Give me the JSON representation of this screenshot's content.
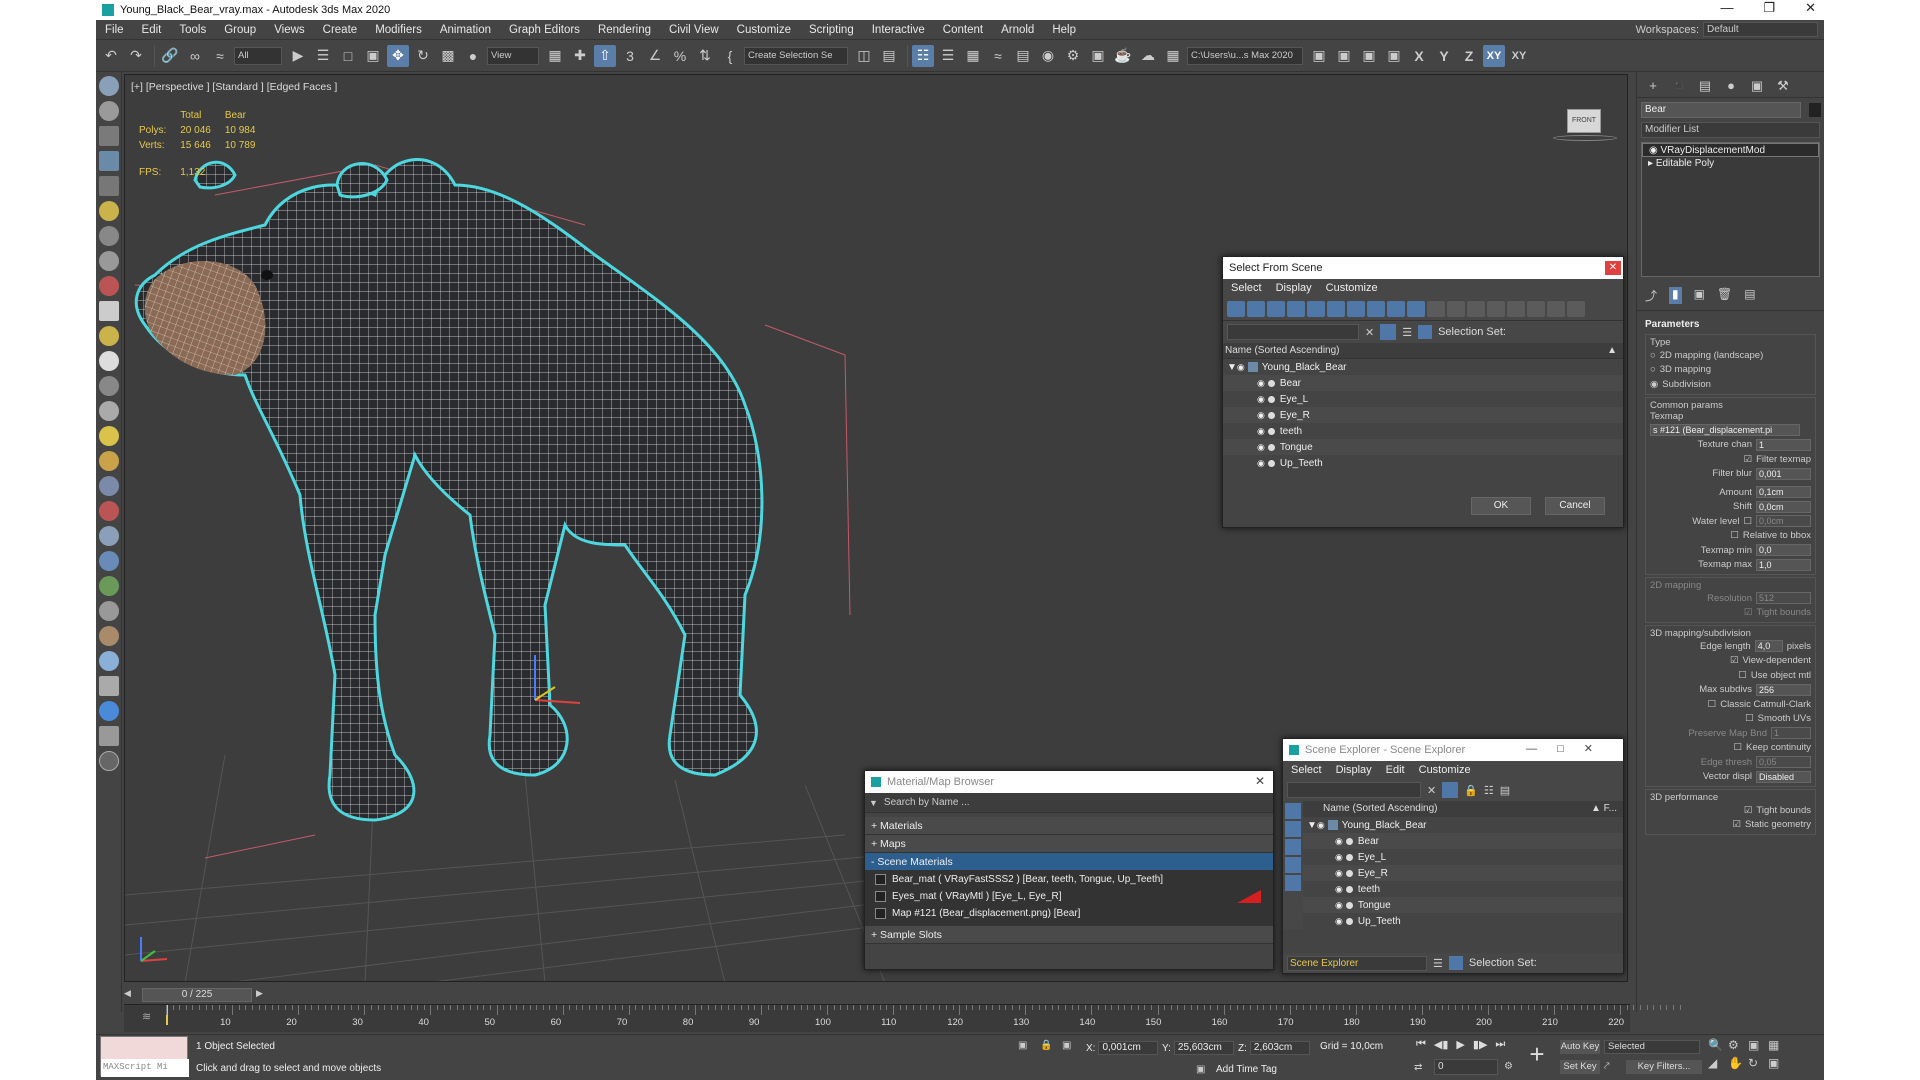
{
  "window": {
    "title": "Young_Black_Bear_vray.max - Autodesk 3ds Max 2020"
  },
  "menu": [
    "File",
    "Edit",
    "Tools",
    "Group",
    "Views",
    "Create",
    "Modifiers",
    "Animation",
    "Graph Editors",
    "Rendering",
    "Civil View",
    "Customize",
    "Scripting",
    "Interactive",
    "Content",
    "Arnold",
    "Help"
  ],
  "workspace": {
    "label": "Workspaces:",
    "value": "Default"
  },
  "toolbar": {
    "filter": "All",
    "ref_coord": "View",
    "selection_set": "Create Selection Se",
    "path": "C:\\Users\\u...s Max 2020",
    "axis": [
      "X",
      "Y",
      "Z",
      "XY",
      "XY"
    ]
  },
  "viewport": {
    "label": "[+] [Perspective ] [Standard ] [Edged Faces ]",
    "stats": {
      "col_total": "Total",
      "col_obj": "Bear",
      "polys_label": "Polys:",
      "polys_total": "20 046",
      "polys_obj": "10 984",
      "verts_label": "Verts:",
      "verts_total": "15 646",
      "verts_obj": "10 789",
      "fps_label": "FPS:",
      "fps": "1,132"
    },
    "viewcube": "FRONT"
  },
  "command_panel": {
    "object_name": "Bear",
    "modifier_list": "Modifier List",
    "stack": [
      "VRayDisplacementMod",
      "Editable Poly"
    ],
    "parameters": {
      "title": "Parameters",
      "type_label": "Type",
      "types": [
        "2D mapping (landscape)",
        "3D mapping",
        "Subdivision"
      ],
      "common": "Common params",
      "texmap_label": "Texmap",
      "texmap": "s #121 (Bear_displacement.pi",
      "texture_chan_label": "Texture chan",
      "texture_chan": "1",
      "filter_texmap": "Filter texmap",
      "filter_blur_label": "Filter blur",
      "filter_blur": "0,001",
      "amount_label": "Amount",
      "amount": "0,1cm",
      "shift_label": "Shift",
      "shift": "0,0cm",
      "water_label": "Water level",
      "water": "0,0cm",
      "relative_bbox": "Relative to bbox",
      "texmap_min_label": "Texmap min",
      "texmap_min": "0,0",
      "texmap_max_label": "Texmap max",
      "texmap_max": "1,0",
      "mapping2d": "2D mapping",
      "resolution_label": "Resolution",
      "resolution": "512",
      "tight_bounds": "Tight bounds",
      "mapping3d": "3D mapping/subdivision",
      "edge_length_label": "Edge length",
      "edge_length": "4,0",
      "pixels": "pixels",
      "view_dependent": "View-dependent",
      "use_object_mtl": "Use object mtl",
      "max_subdivs_label": "Max subdivs",
      "max_subdivs": "256",
      "catmull": "Classic Catmull-Clark",
      "smooth_uvs": "Smooth UVs",
      "preserve_label": "Preserve Map Bnd",
      "preserve": "1",
      "keep_continuity": "Keep continuity",
      "edge_thresh_label": "Edge thresh",
      "edge_thresh": "0,05",
      "vector_disp_label": "Vector displ",
      "vector_disp": "Disabled",
      "perf": "3D performance",
      "tight_bounds2": "Tight bounds",
      "static_geometry": "Static geometry"
    }
  },
  "select_dialog": {
    "title": "Select From Scene",
    "menu": [
      "Select",
      "Display",
      "Customize"
    ],
    "selection_set": "Selection Set:",
    "header": "Name (Sorted Ascending)",
    "root": "Young_Black_Bear",
    "items": [
      "Bear",
      "Eye_L",
      "Eye_R",
      "teeth",
      "Tongue",
      "Up_Teeth"
    ],
    "ok": "OK",
    "cancel": "Cancel"
  },
  "material_browser": {
    "title": "Material/Map Browser",
    "search": "Search by Name ...",
    "sections": [
      "+ Materials",
      "+ Maps",
      "- Scene Materials",
      "+ Sample Slots"
    ],
    "items": [
      "Bear_mat  ( VRayFastSSS2 )  [Bear, teeth, Tongue, Up_Teeth]",
      "Eyes_mat  ( VRayMtl )  [Eye_L, Eye_R]",
      "Map #121 (Bear_displacement.png)  [Bear]"
    ]
  },
  "scene_explorer": {
    "title": "Scene Explorer - Scene Explorer",
    "menu": [
      "Select",
      "Display",
      "Edit",
      "Customize"
    ],
    "header": "Name (Sorted Ascending)",
    "header_right": "▲ F...",
    "root": "Young_Black_Bear",
    "items": [
      "Bear",
      "Eye_L",
      "Eye_R",
      "teeth",
      "Tongue",
      "Up_Teeth"
    ],
    "footer_name": "Scene Explorer",
    "selection_set": "Selection Set:"
  },
  "timeline": {
    "frame": "0 / 225",
    "ticks": [
      "10",
      "20",
      "30",
      "40",
      "50",
      "60",
      "70",
      "80",
      "90",
      "100",
      "110",
      "120",
      "130",
      "140",
      "150",
      "160",
      "170",
      "180",
      "190",
      "200",
      "210",
      "220"
    ]
  },
  "status": {
    "maxscript": "MAXScript Mi",
    "selected": "1 Object Selected",
    "hint": "Click and drag to select and move objects",
    "x_label": "X:",
    "x": "0,001cm",
    "y_label": "Y:",
    "y": "25,603cm",
    "z_label": "Z:",
    "z": "2,603cm",
    "grid": "Grid = 10,0cm",
    "add_time_tag": "Add Time Tag",
    "auto_key": "Auto Key",
    "set_key": "Set Key",
    "key_mode": "Selected",
    "key_filters": "Key Filters...",
    "frame_field": "0"
  },
  "colors": {
    "accent": "#5a7ea8",
    "highlight": "#4dd8e0",
    "stats": "#e6c94a"
  }
}
